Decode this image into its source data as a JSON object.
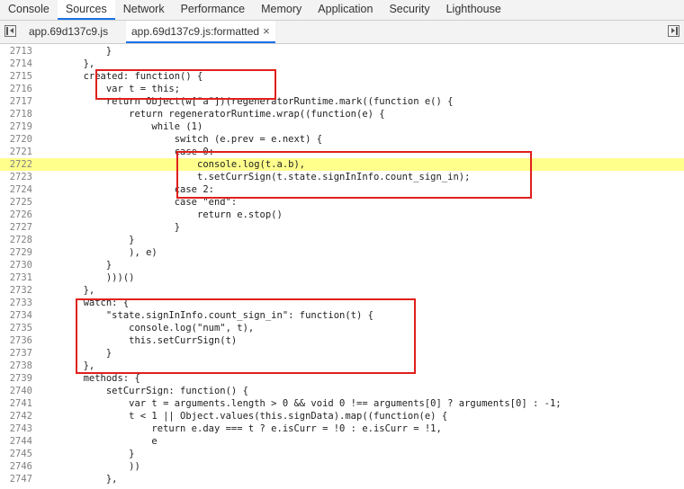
{
  "devtools_tabs": [
    {
      "label": "Console",
      "active": false
    },
    {
      "label": "Sources",
      "active": true
    },
    {
      "label": "Network",
      "active": false
    },
    {
      "label": "Performance",
      "active": false
    },
    {
      "label": "Memory",
      "active": false
    },
    {
      "label": "Application",
      "active": false
    },
    {
      "label": "Security",
      "active": false
    },
    {
      "label": "Lighthouse",
      "active": false
    }
  ],
  "file_tabs": [
    {
      "label": "app.69d137c9.js",
      "active": false
    },
    {
      "label": "app.69d137c9.js:formatted",
      "active": true,
      "close_glyph": "×"
    }
  ],
  "icons": {
    "left": "toggle-navigator-icon",
    "right": "toggle-debugger-icon"
  },
  "highlight_line": "2722",
  "accent_color": "#1a73e8",
  "annotation_color": "#e0201b",
  "highlight_color": "#ffff8c",
  "code_lines": [
    {
      "num": "2713",
      "text": "            }"
    },
    {
      "num": "2714",
      "text": "        },"
    },
    {
      "num": "2715",
      "text": "        created: function() {"
    },
    {
      "num": "2716",
      "text": "            var t = this;"
    },
    {
      "num": "2717",
      "text": "            return Object(w[\"a\"])(regeneratorRuntime.mark((function e() {"
    },
    {
      "num": "2718",
      "text": "                return regeneratorRuntime.wrap((function(e) {"
    },
    {
      "num": "2719",
      "text": "                    while (1)"
    },
    {
      "num": "2720",
      "text": "                        switch (e.prev = e.next) {"
    },
    {
      "num": "2721",
      "text": "                        case 0:"
    },
    {
      "num": "2722",
      "text": "                            console.log(t.a.b),"
    },
    {
      "num": "2723",
      "text": "                            t.setCurrSign(t.state.signInInfo.count_sign_in);"
    },
    {
      "num": "2724",
      "text": "                        case 2:"
    },
    {
      "num": "2725",
      "text": "                        case \"end\":"
    },
    {
      "num": "2726",
      "text": "                            return e.stop()"
    },
    {
      "num": "2727",
      "text": "                        }"
    },
    {
      "num": "2728",
      "text": "                }"
    },
    {
      "num": "2729",
      "text": "                ), e)"
    },
    {
      "num": "2730",
      "text": "            }"
    },
    {
      "num": "2731",
      "text": "            )))()"
    },
    {
      "num": "2732",
      "text": "        },"
    },
    {
      "num": "2733",
      "text": "        watch: {"
    },
    {
      "num": "2734",
      "text": "            \"state.signInInfo.count_sign_in\": function(t) {"
    },
    {
      "num": "2735",
      "text": "                console.log(\"num\", t),"
    },
    {
      "num": "2736",
      "text": "                this.setCurrSign(t)"
    },
    {
      "num": "2737",
      "text": "            }"
    },
    {
      "num": "2738",
      "text": "        },"
    },
    {
      "num": "2739",
      "text": "        methods: {"
    },
    {
      "num": "2740",
      "text": "            setCurrSign: function() {"
    },
    {
      "num": "2741",
      "text": "                var t = arguments.length > 0 && void 0 !== arguments[0] ? arguments[0] : -1;"
    },
    {
      "num": "2742",
      "text": "                t < 1 || Object.values(this.signData).map((function(e) {"
    },
    {
      "num": "2743",
      "text": "                    return e.day === t ? e.isCurr = !0 : e.isCurr = !1,"
    },
    {
      "num": "2744",
      "text": "                    e"
    },
    {
      "num": "2745",
      "text": "                }"
    },
    {
      "num": "2746",
      "text": "                ))"
    },
    {
      "num": "2747",
      "text": "            },"
    }
  ]
}
